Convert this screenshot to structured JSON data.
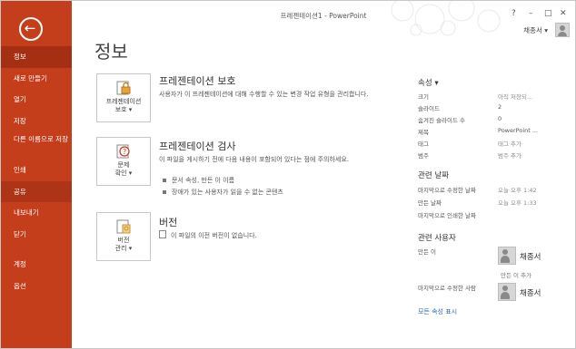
{
  "window": {
    "title": "프레젠테이션1 - PowerPoint",
    "controls": [
      "?",
      "–",
      "□",
      "✕"
    ],
    "user_name": "채종서"
  },
  "sidebar": {
    "items": [
      {
        "label": "정보"
      },
      {
        "label": "새로 만들기"
      },
      {
        "label": "열기"
      },
      {
        "label": "저장"
      },
      {
        "label": "다른 이름으로 저장"
      },
      {
        "label": "인쇄"
      },
      {
        "label": "공유"
      },
      {
        "label": "내보내기"
      },
      {
        "label": "닫기"
      },
      {
        "label": "계정"
      },
      {
        "label": "옵션"
      }
    ]
  },
  "main": {
    "title": "정보",
    "sections": [
      {
        "tile_label_1": "프레젠테이션",
        "tile_label_2": "보호 ▾",
        "heading": "프레젠테이션 보호",
        "desc": "사용자가 이 프레젠테이션에 대해 수행할 수 있는 변경 작업 유형을 관리합니다."
      },
      {
        "tile_label_1": "문제",
        "tile_label_2": "확인 ▾",
        "heading": "프레젠테이션 검사",
        "desc": "이 파일을 게시하기 전에 다음 내용이 포함되어 있다는 점에 주의하세요.",
        "bullets": [
          "문서 속성, 만든 이 이름",
          "장애가 있는 사용자가 읽을 수 없는 콘텐츠"
        ]
      },
      {
        "tile_label_1": "버전",
        "tile_label_2": "관리 ▾",
        "heading": "버전",
        "desc": "이 파일의 이전 버전이 없습니다."
      }
    ]
  },
  "properties": {
    "heading": "속성 ▾",
    "rows": [
      {
        "key": "크기",
        "value": "아직 저장되..."
      },
      {
        "key": "슬라이드",
        "value": "2"
      },
      {
        "key": "숨겨진 슬라이드 수",
        "value": "0"
      },
      {
        "key": "제목",
        "value": "PowerPoint ..."
      },
      {
        "key": "태그",
        "value": "태그 추가"
      },
      {
        "key": "범주",
        "value": "범주 추가"
      }
    ],
    "dates_heading": "관련 날짜",
    "dates": [
      {
        "key": "마지막으로 수정한 날짜",
        "value": "오늘 오후 1:42"
      },
      {
        "key": "만든 날짜",
        "value": "오늘 오후 1:33"
      },
      {
        "key": "마지막으로 인쇄한 날짜",
        "value": ""
      }
    ],
    "people_heading": "관련 사용자",
    "author_key": "만든 이",
    "author_name": "채종서",
    "add_author": "만든 이 추가",
    "modified_by_key": "마지막으로 수정한 사람",
    "modified_by_name": "채종서",
    "show_all": "모든 속성 표시"
  },
  "colors": {
    "accent": "#c43e1c",
    "active": "#a52f12",
    "link": "#2e6ab3"
  }
}
